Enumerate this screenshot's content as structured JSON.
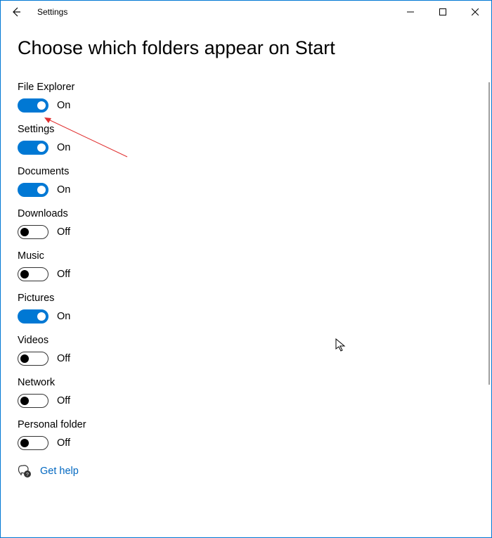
{
  "window": {
    "title": "Settings"
  },
  "page": {
    "heading": "Choose which folders appear on Start"
  },
  "states": {
    "on": "On",
    "off": "Off"
  },
  "options": [
    {
      "label": "File Explorer",
      "on": true
    },
    {
      "label": "Settings",
      "on": true
    },
    {
      "label": "Documents",
      "on": true
    },
    {
      "label": "Downloads",
      "on": false
    },
    {
      "label": "Music",
      "on": false
    },
    {
      "label": "Pictures",
      "on": true
    },
    {
      "label": "Videos",
      "on": false
    },
    {
      "label": "Network",
      "on": false
    },
    {
      "label": "Personal folder",
      "on": false
    }
  ],
  "help": {
    "label": "Get help"
  },
  "colors": {
    "accent": "#0078d4",
    "link": "#0067c0"
  }
}
